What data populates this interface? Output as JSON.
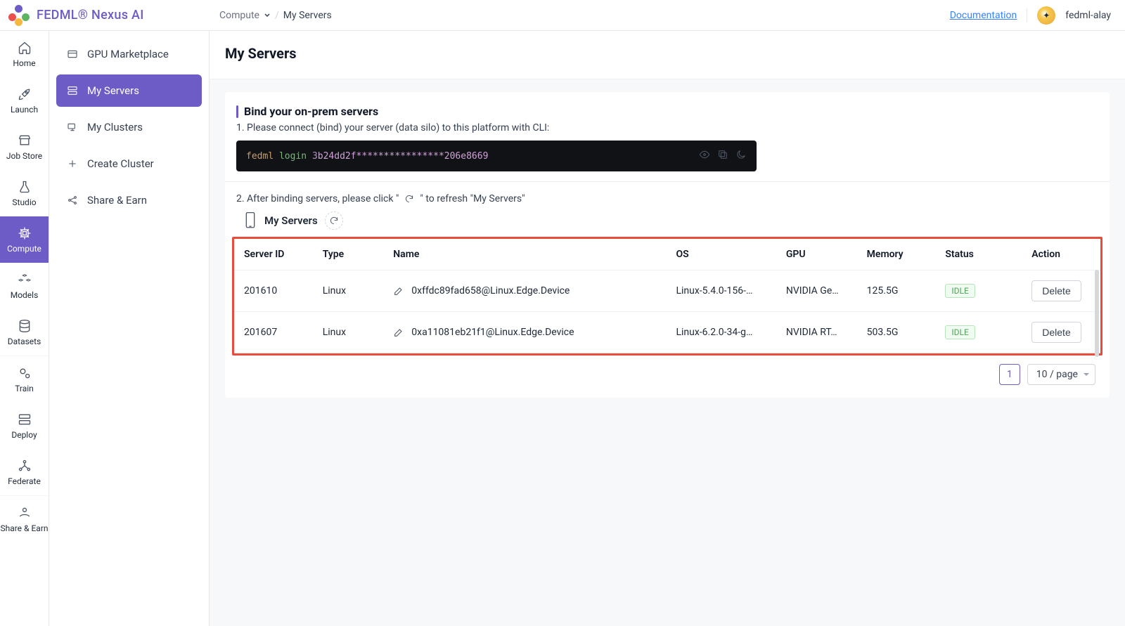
{
  "brand": "FEDML® Nexus AI",
  "breadcrumb": {
    "root": "Compute",
    "current": "My Servers"
  },
  "header": {
    "doc": "Documentation",
    "user": "fedml-alay"
  },
  "rail": {
    "items": [
      {
        "id": "home",
        "label": "Home"
      },
      {
        "id": "launch",
        "label": "Launch"
      },
      {
        "id": "jobstore",
        "label": "Job Store"
      },
      {
        "id": "studio",
        "label": "Studio"
      },
      {
        "id": "compute",
        "label": "Compute"
      },
      {
        "id": "models",
        "label": "Models"
      },
      {
        "id": "datasets",
        "label": "Datasets"
      },
      {
        "id": "train",
        "label": "Train"
      },
      {
        "id": "deploy",
        "label": "Deploy"
      },
      {
        "id": "federate",
        "label": "Federate"
      },
      {
        "id": "share",
        "label": "Share & Earn"
      }
    ]
  },
  "subnav": {
    "items": [
      {
        "id": "gpu-marketplace",
        "label": "GPU Marketplace"
      },
      {
        "id": "my-servers",
        "label": "My Servers"
      },
      {
        "id": "my-clusters",
        "label": "My Clusters"
      },
      {
        "id": "create-cluster",
        "label": "Create Cluster"
      },
      {
        "id": "share-earn",
        "label": "Share & Earn"
      }
    ]
  },
  "page": {
    "title": "My Servers"
  },
  "bind": {
    "title": "Bind your on-prem servers",
    "step1": "1. Please connect (bind) your server (data silo) to this platform with CLI:",
    "cli": {
      "cmd": "fedml",
      "sub": "login",
      "argA": "3",
      "argB": "b24dd2f****************206e8669"
    },
    "step2a": "2. After binding servers, please click \"",
    "step2b": "\" to refresh \"My Servers\"",
    "tableTitle": "My Servers"
  },
  "table": {
    "columns": {
      "id": "Server ID",
      "type": "Type",
      "name": "Name",
      "os": "OS",
      "gpu": "GPU",
      "memory": "Memory",
      "status": "Status",
      "action": "Action"
    },
    "rows": [
      {
        "id": "201610",
        "type": "Linux",
        "name": "0xffdc89fad658@Linux.Edge.Device",
        "os": "Linux-5.4.0-156-…",
        "gpu": "NVIDIA Ge…",
        "memory": "125.5G",
        "status": "IDLE",
        "action": "Delete"
      },
      {
        "id": "201607",
        "type": "Linux",
        "name": "0xa11081eb21f1@Linux.Edge.Device",
        "os": "Linux-6.2.0-34-g…",
        "gpu": "NVIDIA RT…",
        "memory": "503.5G",
        "status": "IDLE",
        "action": "Delete"
      }
    ]
  },
  "pagination": {
    "current": "1",
    "size": "10 / page"
  }
}
